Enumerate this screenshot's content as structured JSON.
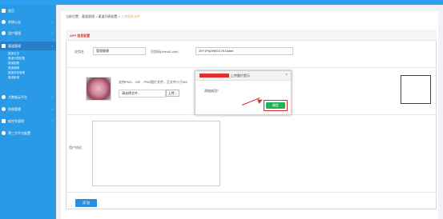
{
  "sidebar": {
    "items": [
      {
        "label": "首页",
        "icon": "home-icon",
        "chevron": ""
      },
      {
        "label": "系统公告",
        "icon": "bell-icon",
        "chevron": "›"
      },
      {
        "label": "用户管理",
        "icon": "user-icon",
        "chevron": "›"
      },
      {
        "label": "渠道管理",
        "icon": "channel-icon",
        "chevron": "›"
      },
      {
        "label": "大数据云平台",
        "icon": "cloud-icon",
        "chevron": "›"
      },
      {
        "label": "系统管理",
        "icon": "gear-icon",
        "chevron": "›"
      },
      {
        "label": "疾控系管理",
        "icon": "monitor-icon",
        "chevron": "›"
      },
      {
        "label": "第三方平台配置",
        "icon": "plug-icon",
        "chevron": ""
      }
    ],
    "sub_items": [
      "渠道总览",
      "渠道列表配置",
      "渠道配置",
      "渠道编辑",
      "渠道类型管理",
      "渠道新增"
    ]
  },
  "breadcrumb": {
    "prefix": "当前位置：渠道管理 > 渠道列表配置 > ",
    "current": "上传图标文件"
  },
  "form": {
    "header": "APP 信息配置",
    "app_name_label": "应用名",
    "app_name_value": "管理健康",
    "checkcode_label": "识别码(checkCode)",
    "checkcode_value": "29Y1Pq09WD17K1kdmt",
    "upload_hint": "支持PNG、GIF、PNG图片文件，且文件小于5M",
    "file_placeholder": "请选择文件...",
    "file_button": "上传...",
    "agreement_label": "用户协议",
    "add_button": "添 加"
  },
  "dialog": {
    "title": "上传图片提示",
    "close": "×",
    "message": "添加成功！",
    "ok_button": "确定"
  },
  "colors": {
    "sidebar": "#2b9ae6",
    "accent": "#2b8fe0",
    "ok": "#22b05a",
    "highlight": "#e02a2a"
  }
}
